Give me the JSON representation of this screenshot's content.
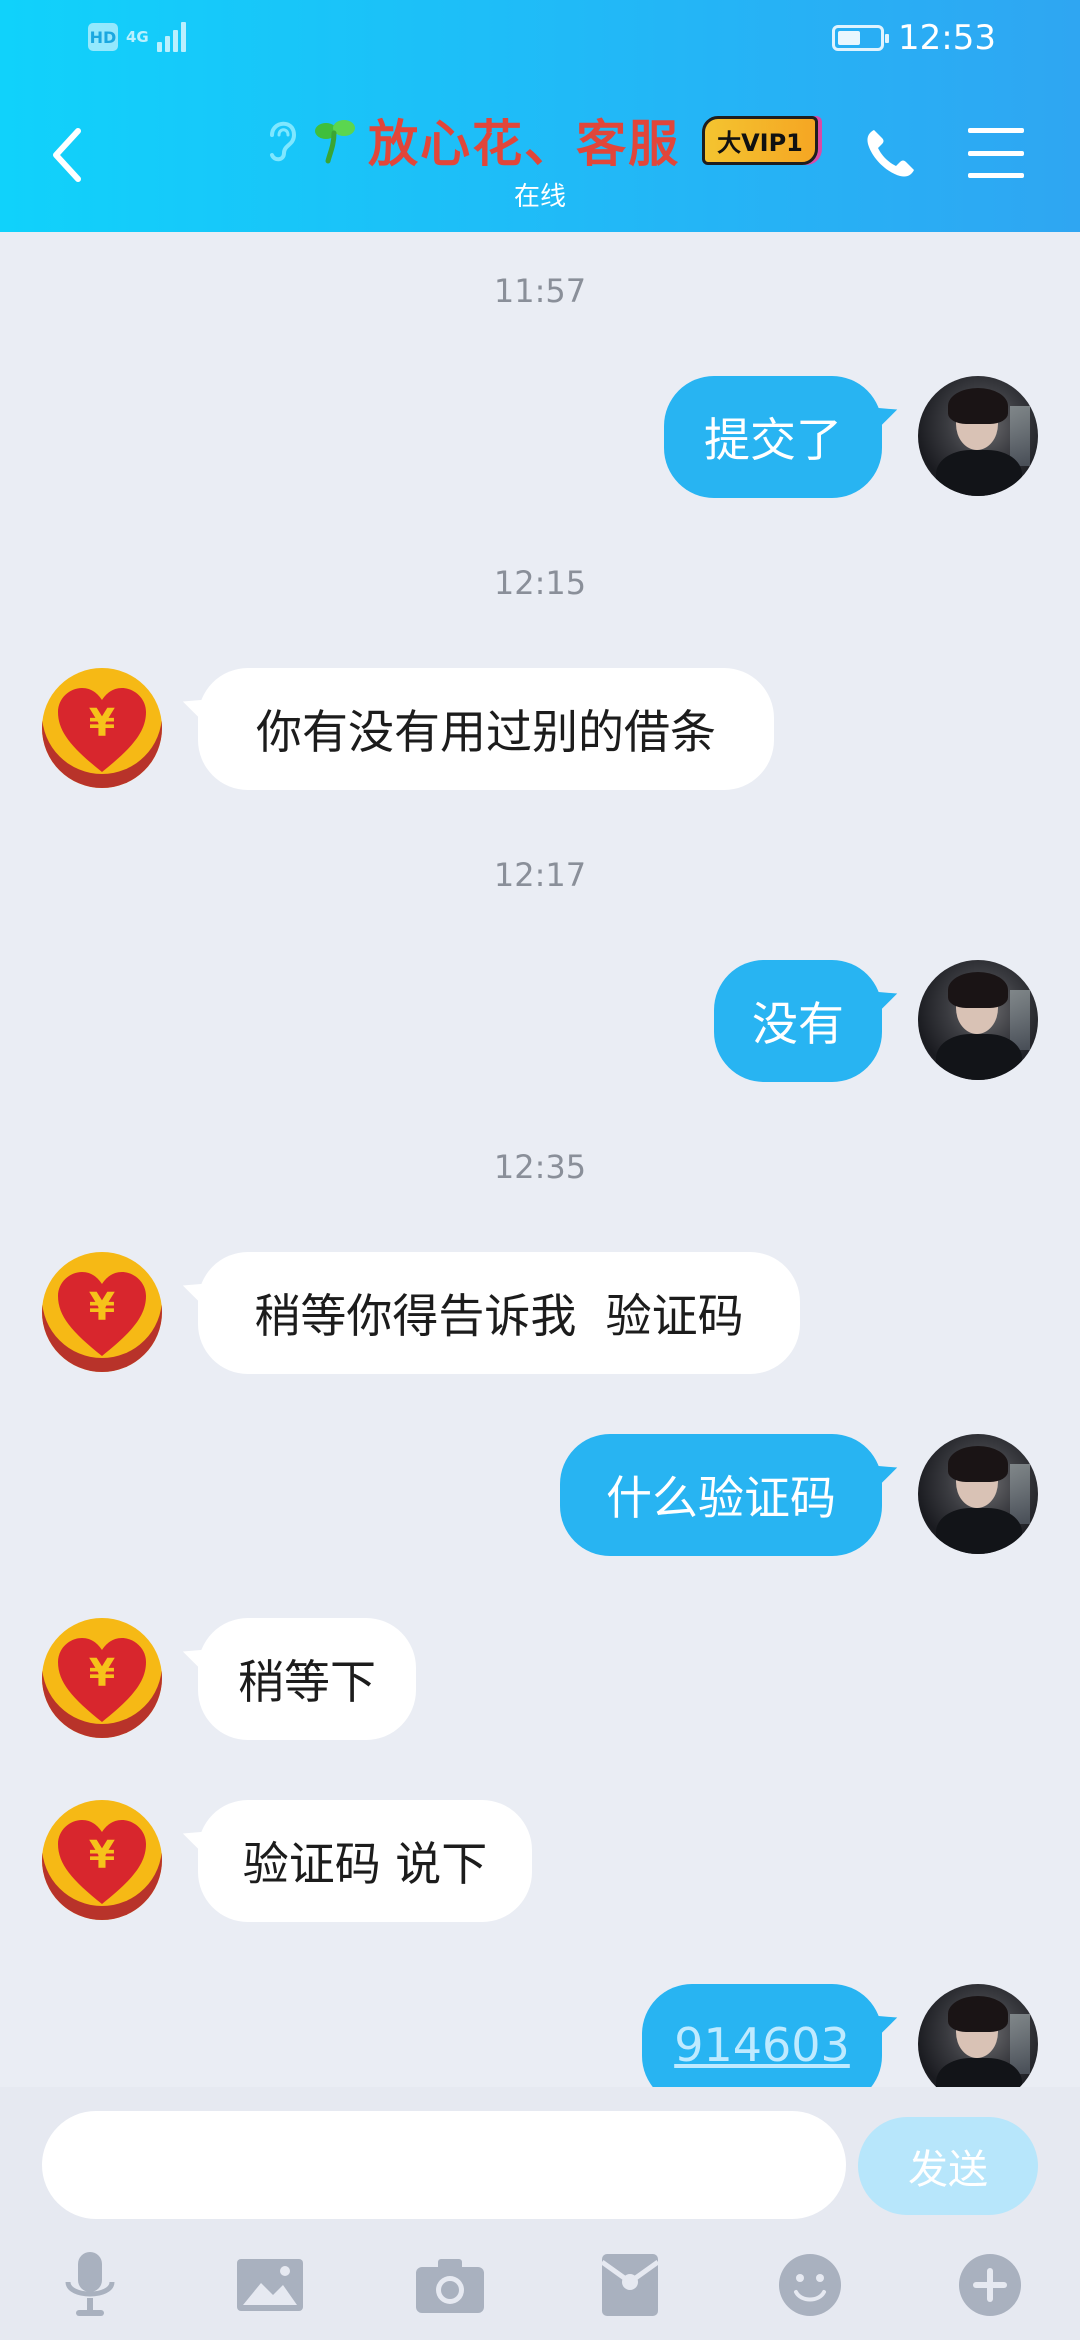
{
  "status_bar": {
    "hd_label": "HD",
    "network_label": "4G",
    "time": "12:53"
  },
  "header": {
    "title": "放心花、客服",
    "vip_badge": "大VIP1",
    "subtitle": "在线"
  },
  "messages": [
    {
      "type": "time",
      "text": "11:57"
    },
    {
      "type": "sent",
      "text": "提交了"
    },
    {
      "type": "time",
      "text": "12:15"
    },
    {
      "type": "received",
      "text": "你有没有用过别的借条"
    },
    {
      "type": "time",
      "text": "12:17"
    },
    {
      "type": "sent",
      "text": "没有"
    },
    {
      "type": "time",
      "text": "12:35"
    },
    {
      "type": "received",
      "text": "稍等你得告诉我  验证码"
    },
    {
      "type": "sent",
      "text": "什么验证码"
    },
    {
      "type": "received",
      "text": "稍等下"
    },
    {
      "type": "received",
      "text": "验证码 说下"
    },
    {
      "type": "sent",
      "text": "914603"
    }
  ],
  "input": {
    "value": "",
    "send_label": "发送"
  },
  "toolbar": {
    "icons": [
      "microphone-icon",
      "image-icon",
      "camera-icon",
      "red-packet-icon",
      "emoji-icon",
      "plus-icon"
    ]
  },
  "colors": {
    "header_start": "#10d2fb",
    "header_end": "#2fa6f2",
    "sent_bubble": "#28b4f2",
    "received_bubble": "#ffffff",
    "title": "#e1463a",
    "chat_bg": "#eaedf4"
  }
}
